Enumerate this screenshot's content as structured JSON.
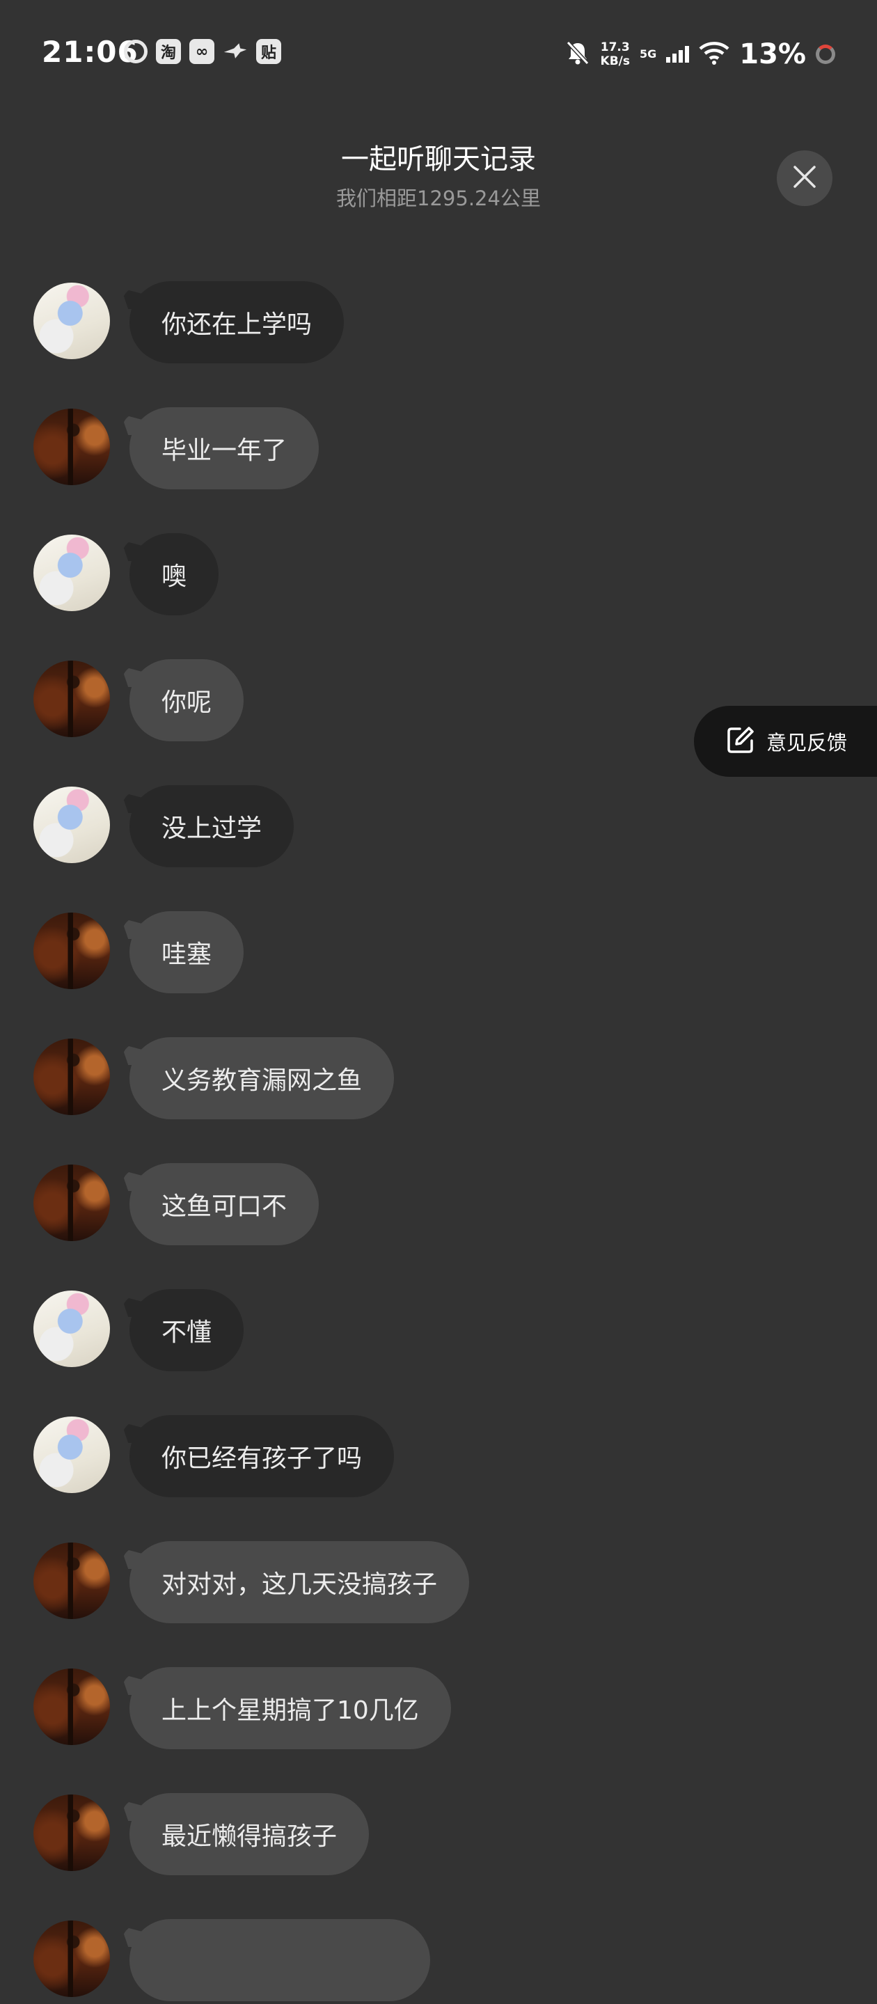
{
  "status_bar": {
    "time": "21:06",
    "app_icons": [
      {
        "name": "weibo-icon",
        "glyph": "⑥",
        "style": "round"
      },
      {
        "name": "taobao-icon",
        "glyph": "淘",
        "style": "box"
      },
      {
        "name": "link-app-icon",
        "glyph": "∞",
        "style": "box"
      },
      {
        "name": "bird-app-icon",
        "glyph": "🕊",
        "style": "plain"
      },
      {
        "name": "tieba-icon",
        "glyph": "贴",
        "style": "box"
      }
    ],
    "mute_icon": "bell-off-icon",
    "net_speed_value": "17.3",
    "net_speed_unit": "KB/s",
    "network_type": "5G",
    "battery": "13%"
  },
  "header": {
    "title": "一起听聊天记录",
    "subtitle": "我们相距1295.24公里",
    "close_icon": "close-icon"
  },
  "feedback": {
    "label": "意见反馈",
    "icon": "edit-icon"
  },
  "messages": [
    {
      "text": "你还在上学吗",
      "sender": "girl"
    },
    {
      "text": "毕业一年了",
      "sender": "dark"
    },
    {
      "text": "噢",
      "sender": "girl"
    },
    {
      "text": "你呢",
      "sender": "dark"
    },
    {
      "text": "没上过学",
      "sender": "girl"
    },
    {
      "text": "哇塞",
      "sender": "dark"
    },
    {
      "text": "义务教育漏网之鱼",
      "sender": "dark"
    },
    {
      "text": "这鱼可口不",
      "sender": "dark"
    },
    {
      "text": "不懂",
      "sender": "girl"
    },
    {
      "text": "你已经有孩子了吗",
      "sender": "girl"
    },
    {
      "text": "对对对，这几天没搞孩子",
      "sender": "dark"
    },
    {
      "text": "上上个星期搞了10几亿",
      "sender": "dark"
    },
    {
      "text": "最近懒得搞孩子",
      "sender": "dark"
    },
    {
      "text": "",
      "sender": "dark"
    }
  ]
}
